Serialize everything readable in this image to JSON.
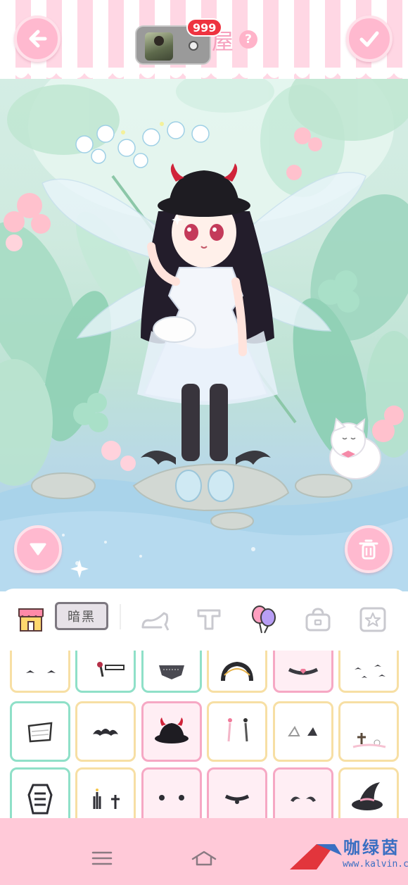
{
  "header": {
    "title": "冒险小屋",
    "badge_count": "999"
  },
  "tabs": {
    "dark_label": "暗黑"
  },
  "watermark": {
    "name": "咖绿茵",
    "url": "www.kalvin.cn"
  },
  "colors": {
    "accent_pink": "#ffb9cf",
    "nav_pink": "#ffc9d8",
    "badge_red": "#ee3340"
  }
}
